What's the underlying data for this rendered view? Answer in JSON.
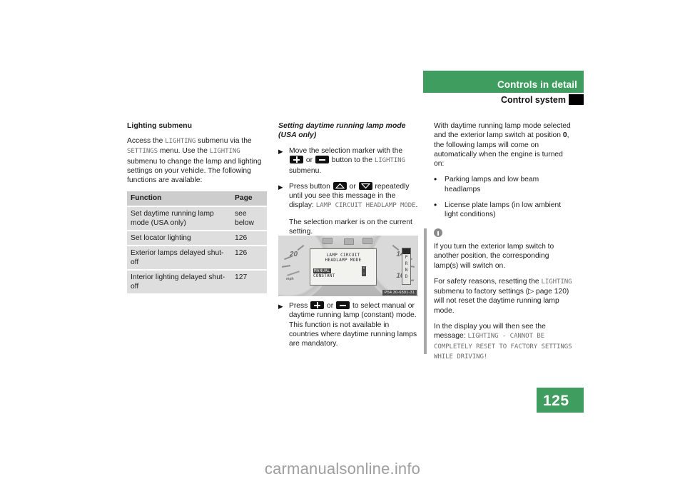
{
  "header": {
    "chapter_title": "Controls in detail",
    "section_title": "Control system",
    "green": "#3f9e5f"
  },
  "page_number": "125",
  "watermark": "carmanualsonline.info",
  "col1": {
    "heading": "Lighting submenu",
    "intro_1": "Access the ",
    "intro_mono_1": "LIGHTING",
    "intro_2": " submenu via the ",
    "intro_mono_2": "SETTINGS",
    "intro_3": " menu. Use the ",
    "intro_mono_3": "LIGHTING",
    "intro_4": " submenu to change the lamp and lighting settings on your vehicle. The following functions are available:",
    "table": {
      "headers": [
        "Function",
        "Page"
      ],
      "rows": [
        {
          "function": "Set daytime running lamp mode (USA only)",
          "page": "see below"
        },
        {
          "function": "Set locator lighting",
          "page": "126"
        },
        {
          "function": "Exterior lamps delayed shut-off",
          "page": "126"
        },
        {
          "function": "Interior lighting delayed shut-off",
          "page": "127"
        }
      ]
    }
  },
  "col2": {
    "heading_line1": "Setting daytime running lamp mode",
    "heading_line2": "(USA only)",
    "step1_a": "Move the selection marker with the ",
    "step1_or": " or ",
    "step1_b": " button to the ",
    "step1_mono": "LIGHTING",
    "step1_c": " submenu.",
    "step2_a": "Press button ",
    "step2_or": " or ",
    "step2_b": " repeatedly until you see this message in the display: ",
    "step2_mono": "LAMP CIRCUIT HEADLAMP MODE",
    "step2_c": ".",
    "note": "The selection marker is on the current setting.",
    "step3_a": "Press ",
    "step3_or": " or ",
    "step3_b": " to select manual or daytime running lamp (constant) mode. This function is not available in countries where daytime running lamps are mandatory.",
    "figure": {
      "lcd_line1": "LAMP CIRCUIT",
      "lcd_line2": "HEADLAMP MODE",
      "lcd_option_selected": "MANUAL",
      "lcd_option_other": "CONSTANT",
      "gear_indicator": "PRND",
      "speed_left": "20",
      "speed_unit": "mph",
      "speed_right_1": "140",
      "speed_right_2": "160",
      "caption": "P54.30-6591-31"
    }
  },
  "col3": {
    "intro_a": "With daytime running lamp mode selected and the exterior lamp switch at position ",
    "intro_bold": "0",
    "intro_b": ", the following lamps will come on automatically when the engine is turned on:",
    "bullets": [
      "Parking lamps and low beam headlamps",
      "License plate lamps (in low ambient light conditions)"
    ],
    "info": {
      "p1": "If you turn the exterior lamp switch to another position, the corresponding lamp(s) will switch on.",
      "p2_a": "For safety reasons, resetting the ",
      "p2_mono": "LIGHTING",
      "p2_b": " submenu to factory settings (▷ page 120) will not reset the daytime running lamp mode.",
      "p3_a": "In the display you will then see the message: ",
      "p3_mono": "LIGHTING - CANNOT BE COMPLETELY RESET TO FACTORY SETTINGS WHILE DRIVING!"
    }
  },
  "icons": {
    "plus": "plus-key-icon",
    "minus": "minus-key-icon",
    "up": "up-arrow-key-icon",
    "down": "down-arrow-key-icon",
    "info": "info-icon",
    "bullet_triangle": "▶",
    "bullet_dot": "•"
  }
}
